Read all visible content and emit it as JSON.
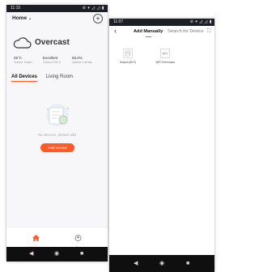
{
  "phone1": {
    "status_bar": {
      "time": "11:15",
      "icons": "⊘ ▾ ◿ ◿ ▮"
    },
    "home_title": "Home",
    "add_button": "+",
    "weather": {
      "condition": "Overcast",
      "stats": [
        {
          "value": "25°C",
          "label": "Outdoor Temper."
        },
        {
          "value": "Excellent",
          "label": "Outdoor PM2.5"
        },
        {
          "value": "55.0%",
          "label": "Outdoor Humidity"
        }
      ]
    },
    "tabs": [
      "All Devices",
      "Living Room"
    ],
    "empty_message": "No devices, please add",
    "add_device_button": "Add Device",
    "bottom_nav": [
      {
        "label": "My Home",
        "icon": "home-icon"
      },
      {
        "label": "Me",
        "icon": "profile-icon"
      }
    ],
    "accent_color": "#ff5a28"
  },
  "phone2": {
    "status_bar": {
      "time": "11:07",
      "icons": "⊘ ▾ ◿ ◿ ▮"
    },
    "tabs": [
      "Add Manually",
      "Search for Device"
    ],
    "devices": [
      {
        "name": "Socket (Wi-Fi)",
        "icon": "socket-icon"
      },
      {
        "name": "WiFi Thermostat",
        "icon": "thermostat-icon",
        "display": "22°C"
      }
    ]
  }
}
